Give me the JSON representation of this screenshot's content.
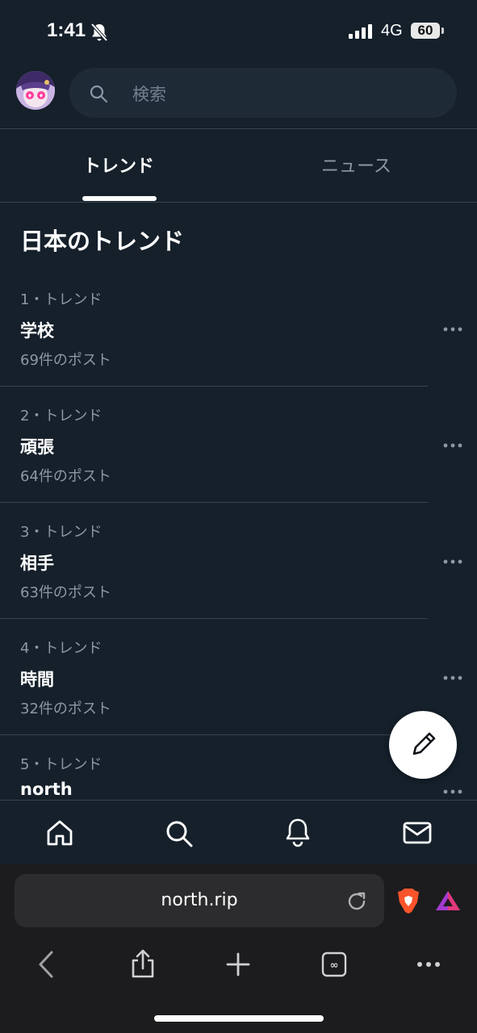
{
  "status_bar": {
    "time": "1:41",
    "network": "4G",
    "battery": "60"
  },
  "search": {
    "placeholder": "検索"
  },
  "tabs": [
    {
      "label": "トレンド",
      "active": true
    },
    {
      "label": "ニュース",
      "active": false
    }
  ],
  "section_title": "日本のトレンド",
  "trends": [
    {
      "meta": "1・トレンド",
      "name": "学校",
      "count": "69件のポスト"
    },
    {
      "meta": "2・トレンド",
      "name": "頑張",
      "count": "64件のポスト"
    },
    {
      "meta": "3・トレンド",
      "name": "相手",
      "count": "63件のポスト"
    },
    {
      "meta": "4・トレンド",
      "name": "時間",
      "count": "32件のポスト"
    },
    {
      "meta": "5・トレンド",
      "name": "north",
      "count": ""
    }
  ],
  "bottom_nav": [
    "home-icon",
    "search-icon",
    "bell-icon",
    "mail-icon"
  ],
  "browser": {
    "url": "north.rip"
  },
  "colors": {
    "background": "#15202b",
    "muted_text": "#8b98a5",
    "divider": "#38444d",
    "brave_orange": "#fb542b"
  }
}
